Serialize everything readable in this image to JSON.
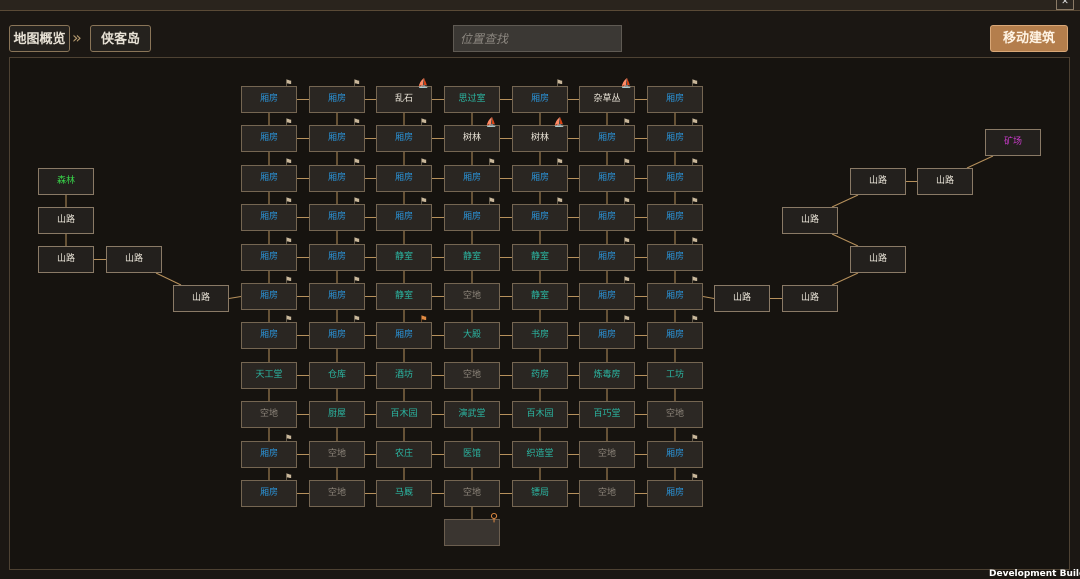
{
  "window": {
    "close_glyph": "✕"
  },
  "breadcrumb": {
    "root": "地图概览",
    "separator": "»",
    "current": "侠客岛"
  },
  "search": {
    "placeholder": "位置查找"
  },
  "toolbar": {
    "move_building_label": "移动建筑"
  },
  "footer": {
    "dev_build": "Development Build"
  },
  "colors": {
    "room_label": "#2a93d8",
    "building_label": "#2bb7a3",
    "plain_label": "#ece6da",
    "empty_label": "#8d857a",
    "forest_label": "#38d64a",
    "mine_label": "#c83ac8",
    "accent_button": "#b47e4c",
    "connector": "#b7915c"
  },
  "grid": {
    "rows": [
      [
        {
          "label": "厢房",
          "kind": "room",
          "flag": "flag"
        },
        {
          "label": "厢房",
          "kind": "room",
          "flag": "flag"
        },
        {
          "label": "乱石",
          "kind": "white",
          "flag": "ship"
        },
        {
          "label": "思过室",
          "kind": "bld"
        },
        {
          "label": "厢房",
          "kind": "room",
          "flag": "flag"
        },
        {
          "label": "杂草丛",
          "kind": "white",
          "flag": "ship"
        },
        {
          "label": "厢房",
          "kind": "room",
          "flag": "flag"
        }
      ],
      [
        {
          "label": "厢房",
          "kind": "room",
          "flag": "flag"
        },
        {
          "label": "厢房",
          "kind": "room",
          "flag": "flag"
        },
        {
          "label": "厢房",
          "kind": "room",
          "flag": "flag"
        },
        {
          "label": "树林",
          "kind": "white",
          "flag": "ship"
        },
        {
          "label": "树林",
          "kind": "white",
          "flag": "ship"
        },
        {
          "label": "厢房",
          "kind": "room",
          "flag": "flag"
        },
        {
          "label": "厢房",
          "kind": "room",
          "flag": "flag"
        }
      ],
      [
        {
          "label": "厢房",
          "kind": "room",
          "flag": "flag"
        },
        {
          "label": "厢房",
          "kind": "room",
          "flag": "flag"
        },
        {
          "label": "厢房",
          "kind": "room",
          "flag": "flag"
        },
        {
          "label": "厢房",
          "kind": "room",
          "flag": "flag"
        },
        {
          "label": "厢房",
          "kind": "room",
          "flag": "flag"
        },
        {
          "label": "厢房",
          "kind": "room",
          "flag": "flag"
        },
        {
          "label": "厢房",
          "kind": "room",
          "flag": "flag"
        }
      ],
      [
        {
          "label": "厢房",
          "kind": "room",
          "flag": "flag"
        },
        {
          "label": "厢房",
          "kind": "room",
          "flag": "flag"
        },
        {
          "label": "厢房",
          "kind": "room",
          "flag": "flag"
        },
        {
          "label": "厢房",
          "kind": "room",
          "flag": "flag"
        },
        {
          "label": "厢房",
          "kind": "room",
          "flag": "flag"
        },
        {
          "label": "厢房",
          "kind": "room",
          "flag": "flag"
        },
        {
          "label": "厢房",
          "kind": "room",
          "flag": "flag"
        }
      ],
      [
        {
          "label": "厢房",
          "kind": "room",
          "flag": "flag"
        },
        {
          "label": "厢房",
          "kind": "room",
          "flag": "flag"
        },
        {
          "label": "静室",
          "kind": "bld"
        },
        {
          "label": "静室",
          "kind": "bld"
        },
        {
          "label": "静室",
          "kind": "bld"
        },
        {
          "label": "厢房",
          "kind": "room",
          "flag": "flag"
        },
        {
          "label": "厢房",
          "kind": "room",
          "flag": "flag"
        }
      ],
      [
        {
          "label": "厢房",
          "kind": "room",
          "flag": "flag"
        },
        {
          "label": "厢房",
          "kind": "room",
          "flag": "flag"
        },
        {
          "label": "静室",
          "kind": "bld"
        },
        {
          "label": "空地",
          "kind": "empty"
        },
        {
          "label": "静室",
          "kind": "bld"
        },
        {
          "label": "厢房",
          "kind": "room",
          "flag": "flag"
        },
        {
          "label": "厢房",
          "kind": "room",
          "flag": "flag"
        }
      ],
      [
        {
          "label": "厢房",
          "kind": "room",
          "flag": "flag"
        },
        {
          "label": "厢房",
          "kind": "room",
          "flag": "flag"
        },
        {
          "label": "厢房",
          "kind": "room",
          "flag": "flag-orange"
        },
        {
          "label": "大殿",
          "kind": "bld"
        },
        {
          "label": "书房",
          "kind": "bld"
        },
        {
          "label": "厢房",
          "kind": "room",
          "flag": "flag"
        },
        {
          "label": "厢房",
          "kind": "room",
          "flag": "flag"
        }
      ],
      [
        {
          "label": "天工堂",
          "kind": "bld"
        },
        {
          "label": "仓库",
          "kind": "bld"
        },
        {
          "label": "酒坊",
          "kind": "bld"
        },
        {
          "label": "空地",
          "kind": "empty"
        },
        {
          "label": "药房",
          "kind": "bld"
        },
        {
          "label": "炼毒房",
          "kind": "bld"
        },
        {
          "label": "工坊",
          "kind": "bld"
        }
      ],
      [
        {
          "label": "空地",
          "kind": "empty"
        },
        {
          "label": "厨屋",
          "kind": "bld"
        },
        {
          "label": "百木园",
          "kind": "bld"
        },
        {
          "label": "演武堂",
          "kind": "bld"
        },
        {
          "label": "百木园",
          "kind": "bld"
        },
        {
          "label": "百巧堂",
          "kind": "bld"
        },
        {
          "label": "空地",
          "kind": "empty"
        }
      ],
      [
        {
          "label": "厢房",
          "kind": "room",
          "flag": "flag"
        },
        {
          "label": "空地",
          "kind": "empty"
        },
        {
          "label": "农庄",
          "kind": "bld"
        },
        {
          "label": "医馆",
          "kind": "bld"
        },
        {
          "label": "织造堂",
          "kind": "bld"
        },
        {
          "label": "空地",
          "kind": "empty"
        },
        {
          "label": "厢房",
          "kind": "room",
          "flag": "flag"
        }
      ],
      [
        {
          "label": "厢房",
          "kind": "room",
          "flag": "flag"
        },
        {
          "label": "空地",
          "kind": "empty"
        },
        {
          "label": "马厩",
          "kind": "bld"
        },
        {
          "label": "空地",
          "kind": "empty"
        },
        {
          "label": "镖局",
          "kind": "bld"
        },
        {
          "label": "空地",
          "kind": "empty"
        },
        {
          "label": "厢房",
          "kind": "room",
          "flag": "flag"
        }
      ]
    ],
    "gate": {
      "label": "",
      "icon": "map-pin-icon"
    }
  },
  "west_path": [
    {
      "id": "forest",
      "label": "森林",
      "kind": "forest"
    },
    {
      "id": "road1",
      "label": "山路",
      "kind": "white"
    },
    {
      "id": "road2",
      "label": "山路",
      "kind": "white"
    },
    {
      "id": "road3",
      "label": "山路",
      "kind": "white"
    },
    {
      "id": "road4",
      "label": "山路",
      "kind": "white"
    }
  ],
  "east_path": [
    {
      "id": "road1",
      "label": "山路",
      "kind": "white"
    },
    {
      "id": "road2",
      "label": "山路",
      "kind": "white"
    },
    {
      "id": "road3",
      "label": "山路",
      "kind": "white"
    },
    {
      "id": "road4",
      "label": "山路",
      "kind": "white"
    },
    {
      "id": "road5",
      "label": "山路",
      "kind": "white"
    },
    {
      "id": "road6",
      "label": "山路",
      "kind": "white"
    },
    {
      "id": "mine",
      "label": "矿场",
      "kind": "mine"
    }
  ]
}
